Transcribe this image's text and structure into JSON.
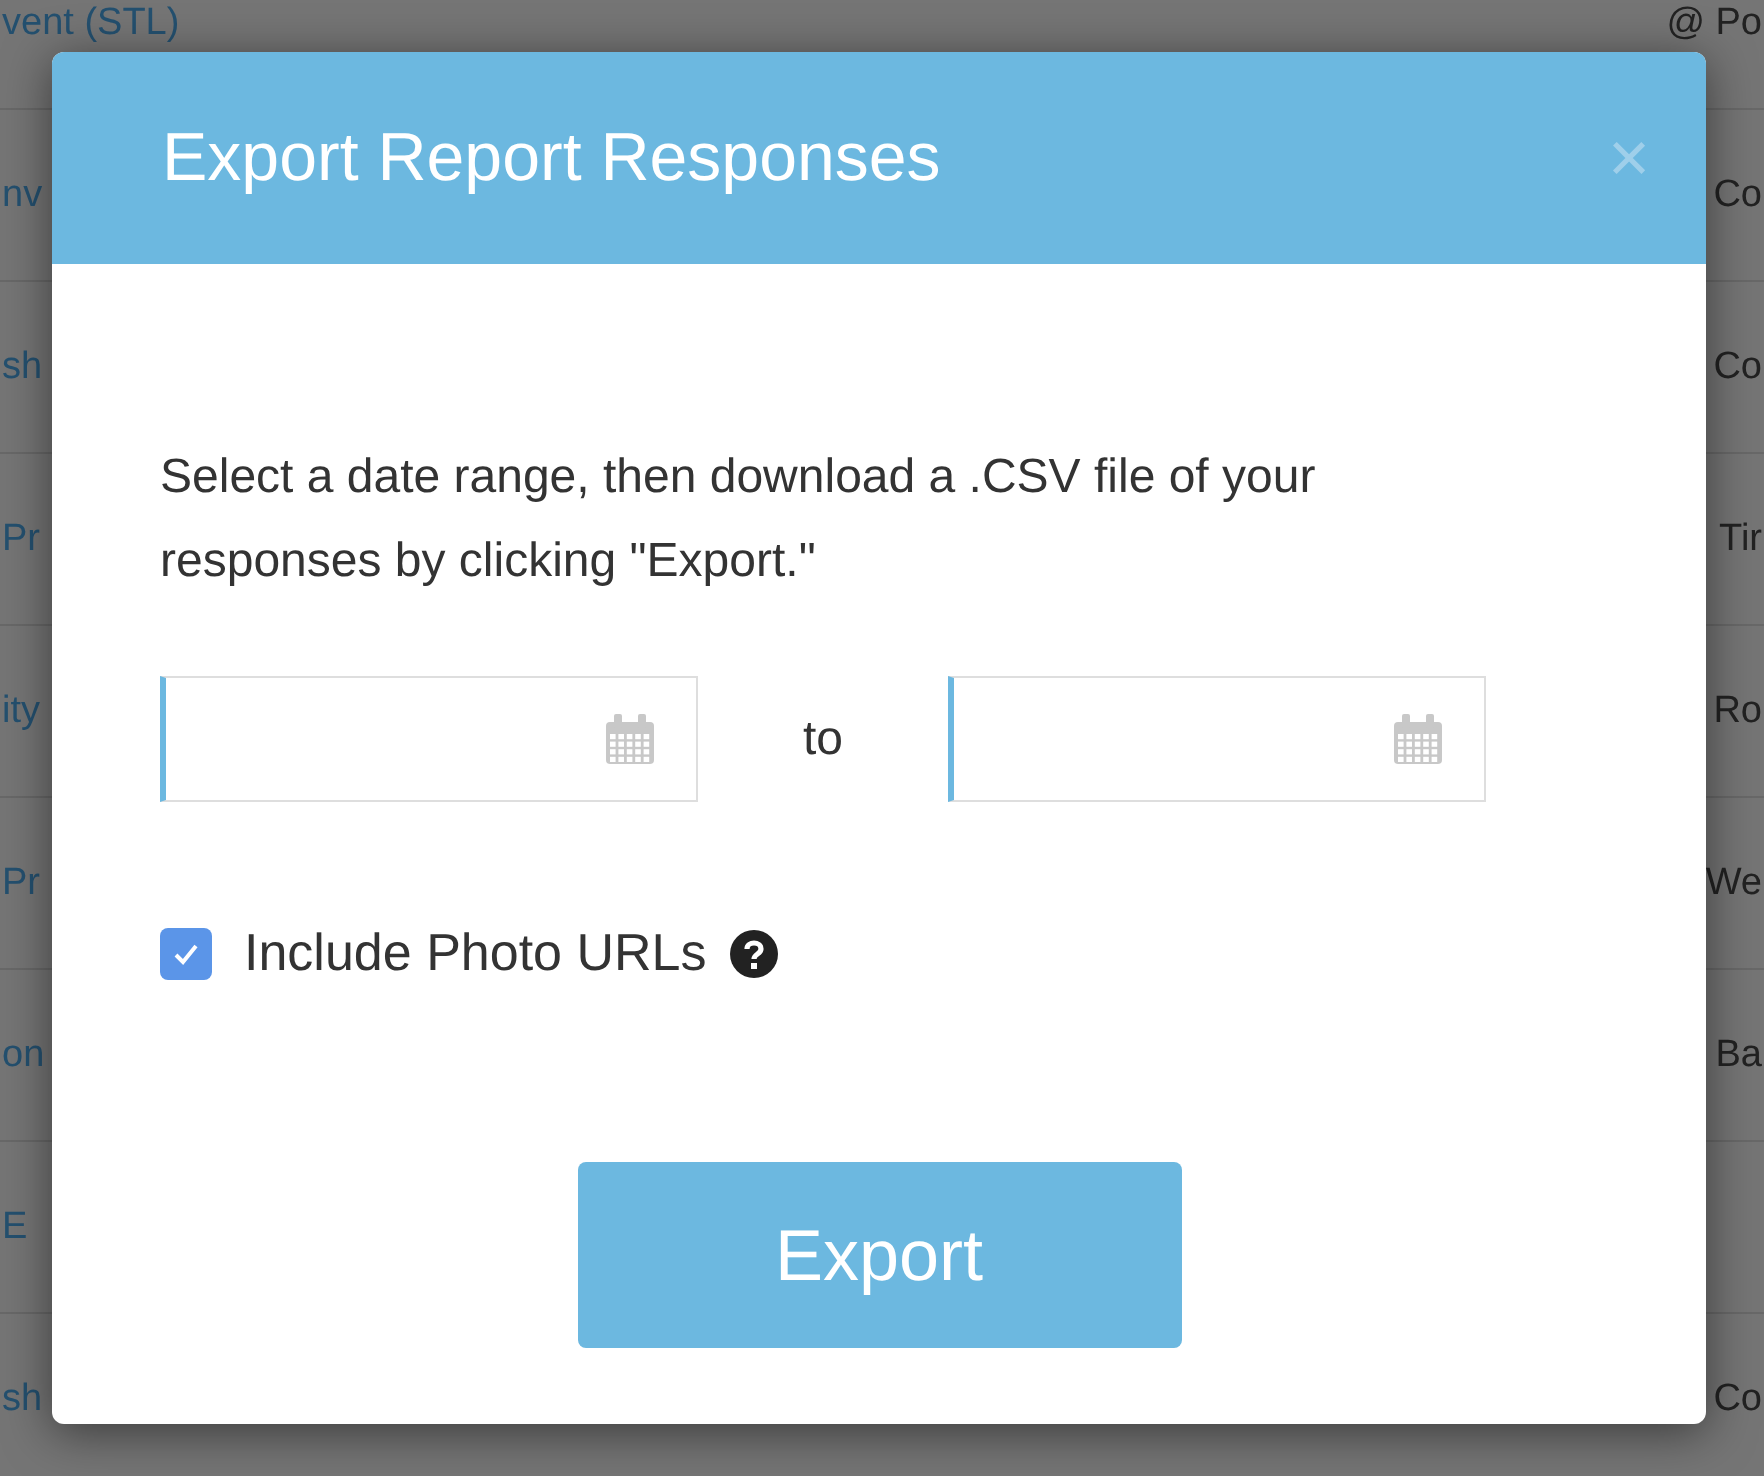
{
  "background_table": {
    "rows": [
      {
        "column_1": "vent (STL)",
        "column_2": "@ Po"
      },
      {
        "column_1": "nv",
        "column_2": "Co"
      },
      {
        "column_1": "sh",
        "column_2": "Co"
      },
      {
        "column_1": "Pr",
        "column_2": "Tir"
      },
      {
        "column_1": "ity",
        "column_2": "Ro"
      },
      {
        "column_1": "Pr",
        "column_2": "We"
      },
      {
        "column_1": "on",
        "column_2": "Ba"
      },
      {
        "column_1": "E"
      },
      {
        "column_1": "sh",
        "column_2": "Co"
      }
    ]
  },
  "dialog": {
    "title": "Export Report Responses",
    "close": "×",
    "description": "Select a date range, then download a .CSV file of your responses by clicking \"Export.\"",
    "date_range": {
      "separator": "to"
    },
    "include_photo_urls": {
      "label": "Include Photo URLs",
      "checked": true
    },
    "export_button": "Export"
  }
}
